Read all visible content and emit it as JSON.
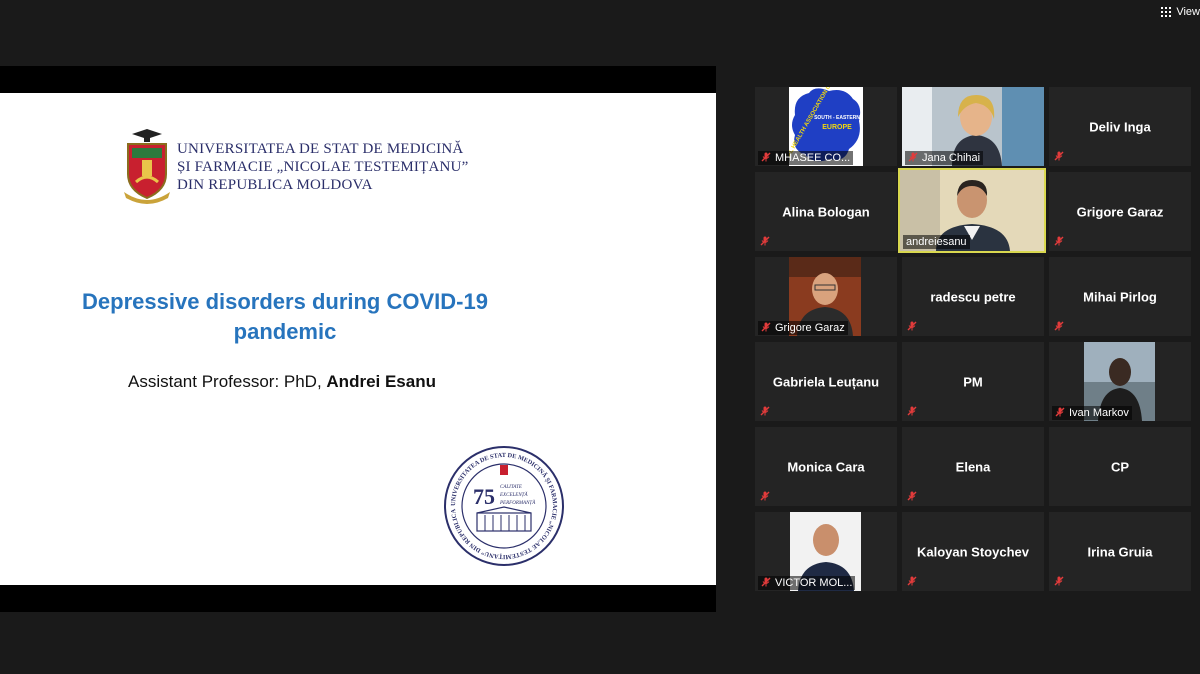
{
  "top": {
    "view_label": "View"
  },
  "slide": {
    "university_lines": [
      "UNIVERSITATEA DE STAT DE MEDICINĂ",
      "ȘI FARMACIE „NICOLAE TESTEMIȚANU”",
      "DIN REPUBLICA MOLDOVA"
    ],
    "title_line1": "Depressive disorders during COVID-19",
    "title_line2": "pandemic",
    "author_prefix": "Assistant Professor: PhD, ",
    "author_name": "Andrei Esanu",
    "seal": {
      "number": "75",
      "motto": [
        "CALITATE",
        "EXCELENȚĂ",
        "PERFORMANȚĂ"
      ],
      "ring_text": "UNIVERSITATEA DE STAT DE MEDICINĂ ȘI FARMACIE „NICOLAE TESTEMIȚANU” DIN REPUBLICA MOLDOVA"
    }
  },
  "logo_mhasee": {
    "ring_text": "MENTAL HEALTH ASSOCIATION OF",
    "line1": "SOUTH - EASTERN",
    "line2": "EUROPE"
  },
  "participants": [
    {
      "label": "MHASEE CO...",
      "video": true
    },
    {
      "label": "Jana Chihai",
      "video": true
    },
    {
      "name": "Deliv Inga",
      "video": false
    },
    {
      "name": "Alina Bologan",
      "video": false
    },
    {
      "label": "andreiesanu",
      "video": true,
      "active": true
    },
    {
      "name": "Grigore Garaz",
      "video": false
    },
    {
      "label": "Grigore Garaz",
      "video": true
    },
    {
      "name": "radescu petre",
      "video": false
    },
    {
      "name": "Mihai Pirlog",
      "video": false
    },
    {
      "name": "Gabriela Leuțanu",
      "video": false
    },
    {
      "name": "PM",
      "video": false
    },
    {
      "label": "Ivan Markov",
      "video": true
    },
    {
      "name": "Monica Cara",
      "video": false
    },
    {
      "name": "Elena",
      "video": false
    },
    {
      "name": "CP",
      "video": false
    },
    {
      "label": "VICTOR MOL...",
      "video": true
    },
    {
      "name": "Kaloyan Stoychev",
      "video": false
    },
    {
      "name": "Irina Gruia",
      "video": false
    }
  ],
  "colors": {
    "background": "#1a1a1a",
    "tile": "#242424",
    "active_border": "#d9d84f",
    "slide_title": "#2774bd",
    "uni_text": "#2b2f6a",
    "mute": "#e23b3b"
  }
}
